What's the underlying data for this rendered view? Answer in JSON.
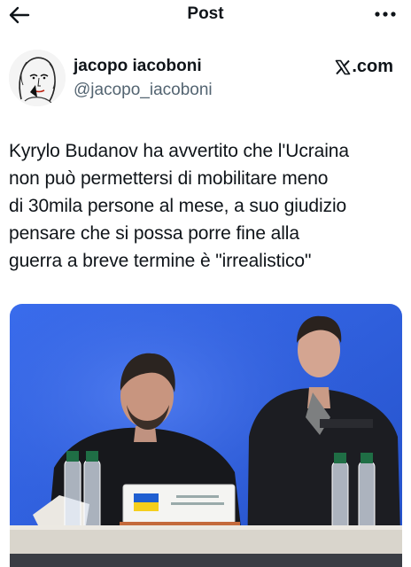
{
  "header": {
    "title": "Post",
    "back_icon": "arrow-left-icon",
    "more_icon": "more-horizontal-icon"
  },
  "author": {
    "name": "jacopo iacoboni",
    "handle": "@jacopo_iacoboni",
    "source": ".com",
    "source_icon": "x-logo-icon"
  },
  "tweet": {
    "lines": [
      "Kyrylo Budanov ha avvertito che l'Ucraina",
      "non può permettersi di mobilitare meno",
      "di 30mila persone al mese, a suo giudizio",
      "pensare che si possa porre fine alla",
      "guerra a breve termine è \"irrealistico\""
    ]
  },
  "media": {
    "colors": {
      "background": "#2f5fe0",
      "table": "#d9d5cc",
      "flag_blue": "#1f5fd1",
      "flag_yellow": "#f5cf1c"
    }
  }
}
